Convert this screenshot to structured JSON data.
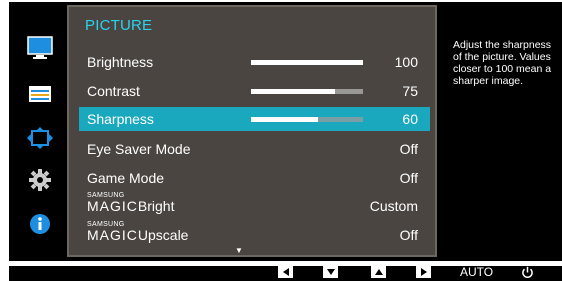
{
  "menu": {
    "title": "PICTURE",
    "items": [
      {
        "label": "Brightness",
        "value": "100",
        "level": 100
      },
      {
        "label": "Contrast",
        "value": "75",
        "level": 75
      },
      {
        "label": "Sharpness",
        "value": "60",
        "level": 60,
        "selected": true
      },
      {
        "label": "Eye Saver Mode",
        "value": "Off"
      },
      {
        "label": "Game Mode",
        "value": "Off"
      },
      {
        "label_prefix": "MAGIC",
        "label_super": "SAMSUNG",
        "label": "Bright",
        "value": "Custom"
      },
      {
        "label_prefix": "MAGIC",
        "label_super": "SAMSUNG",
        "label": "Upscale",
        "value": "Off"
      }
    ],
    "more_indicator": "▼"
  },
  "help": {
    "text": "Adjust the sharpness of the picture. Values closer to 100 mean a sharper image."
  },
  "keybar": {
    "auto_label": "AUTO"
  },
  "rail_icons": [
    "picture-icon",
    "onscreen-display-icon",
    "position-size-icon",
    "system-gear-icon",
    "information-icon"
  ],
  "colors": {
    "accent": "#27d4ef",
    "selected_row": "#1aa8be",
    "panel_bg": "#4a4541",
    "info_icon": "#1e8fe0"
  }
}
